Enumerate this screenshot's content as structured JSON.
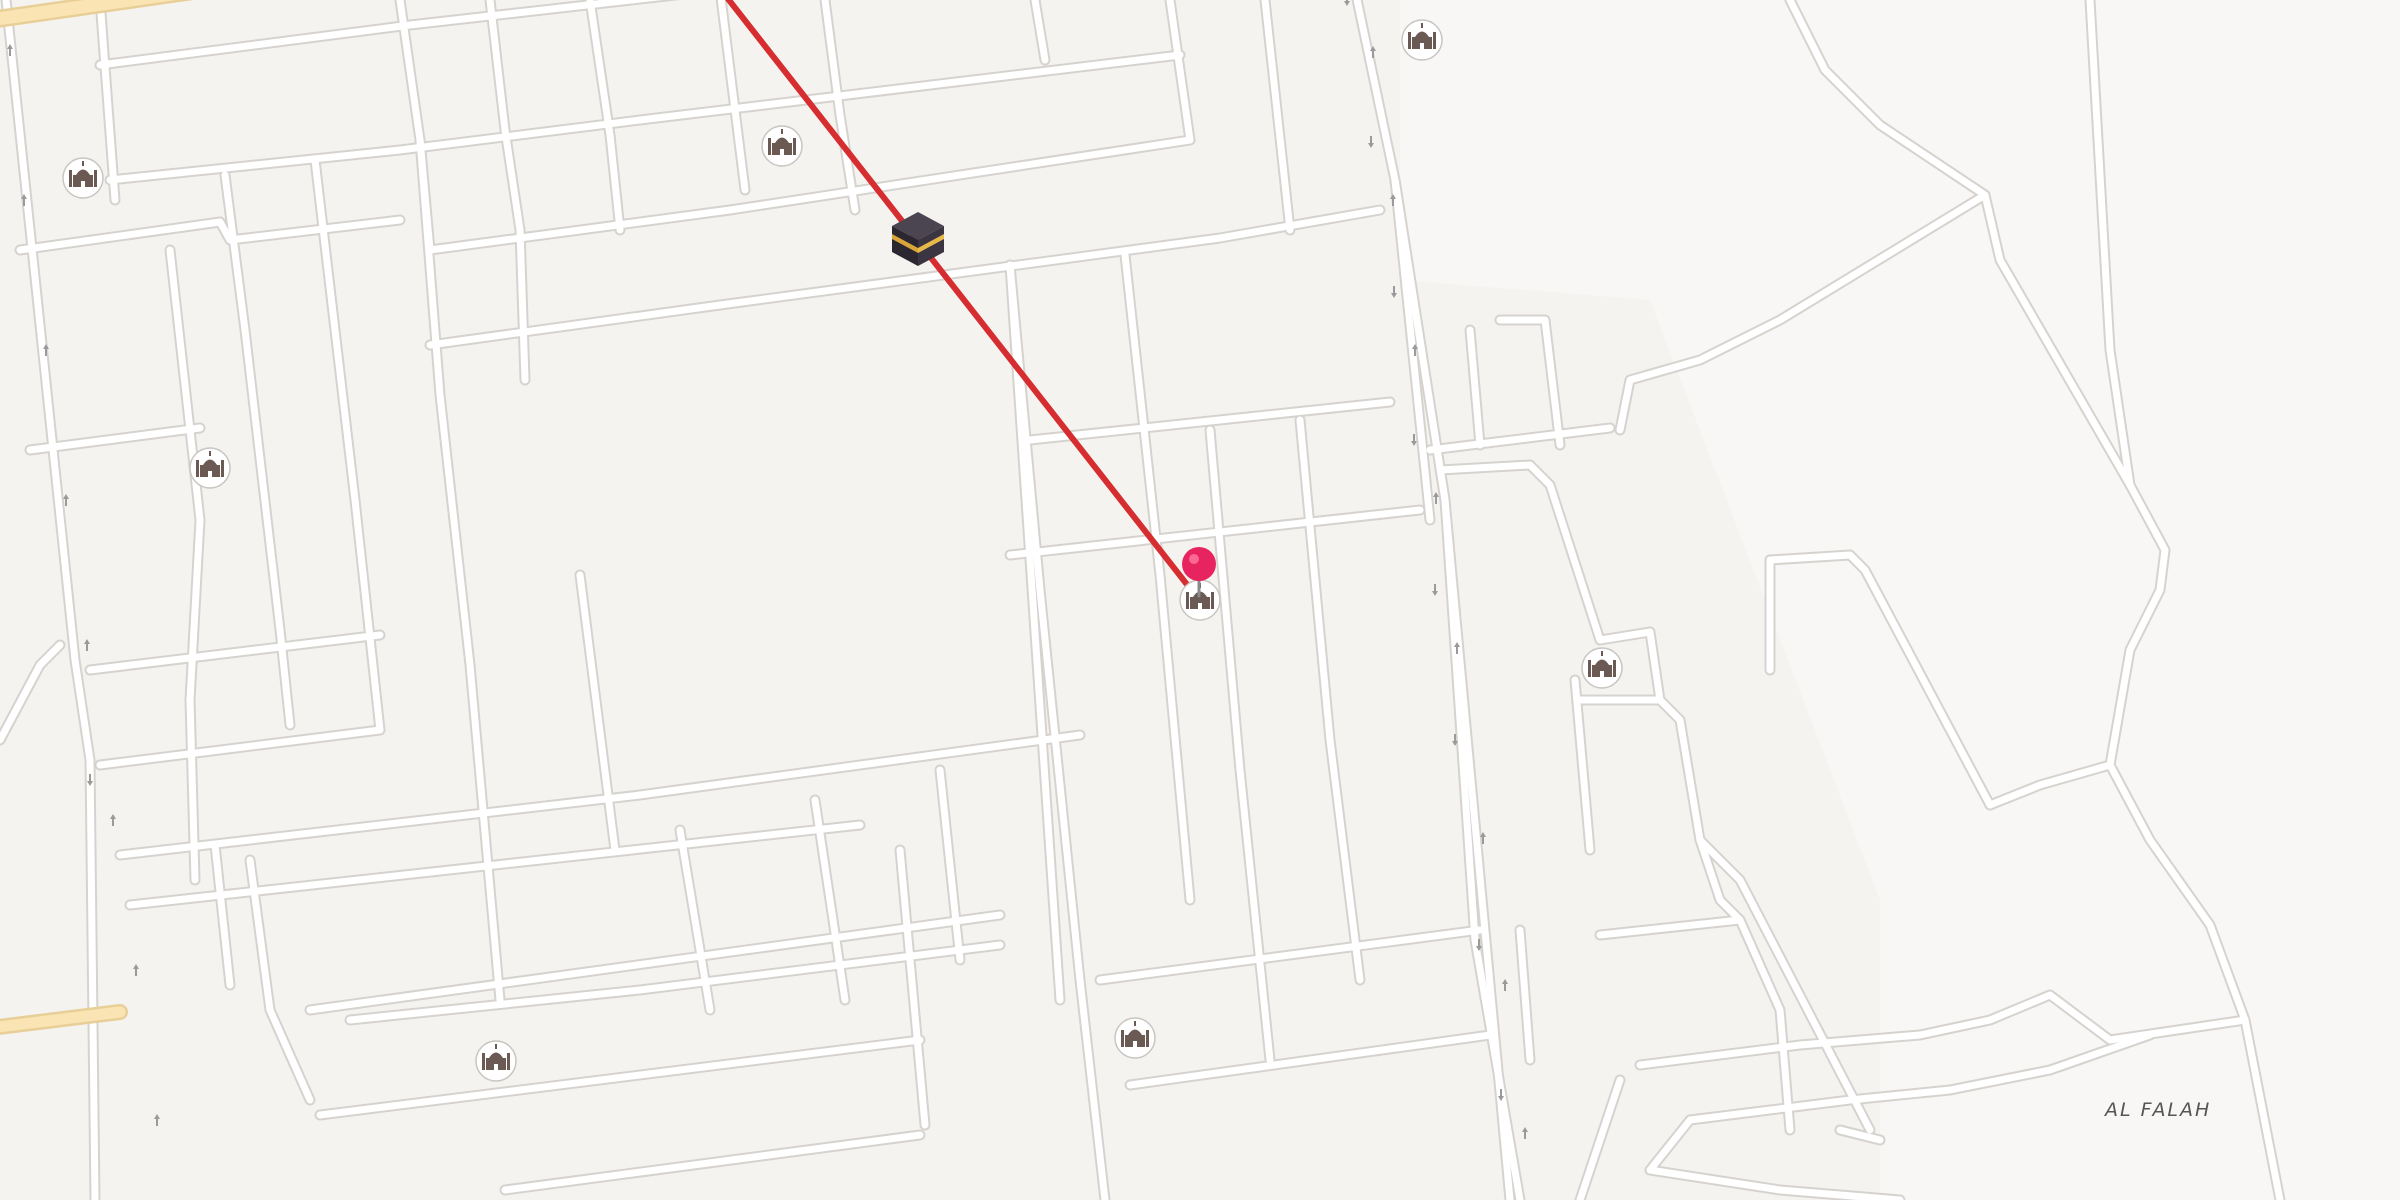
{
  "map": {
    "labels": {
      "district": "AL FALAH"
    },
    "colors": {
      "background": "#f5f3f0",
      "road_casing": "#d6d3cf",
      "road_fill": "#ffffff",
      "major_road_casing": "#e8cf97",
      "major_road_fill": "#fbe4b3",
      "qibla_line": "#d62d30",
      "pin": "#e8245f",
      "mosque_icon": "#6b5a53"
    },
    "icons": {
      "mosque": "mosque-icon",
      "kaaba": "kaaba-icon",
      "pin": "location-pin-icon",
      "one_way": "one-way-arrow-icon"
    },
    "markers": {
      "qibla_target": "kaaba",
      "user_location": "pin"
    }
  }
}
